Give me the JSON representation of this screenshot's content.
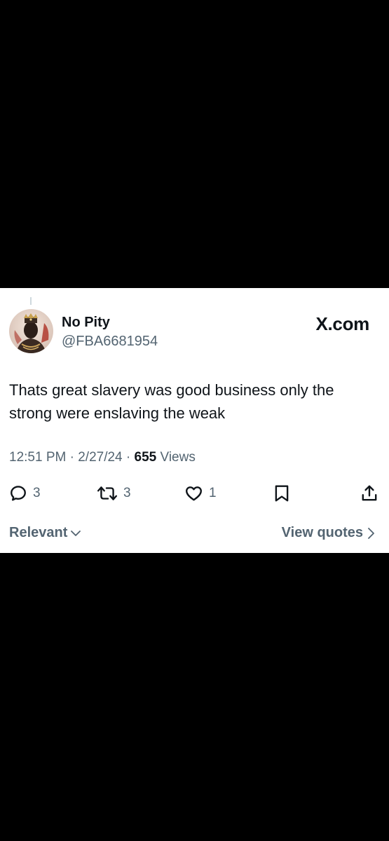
{
  "tweet": {
    "author_name": "No Pity",
    "author_handle": "@FBA6681954",
    "brand": "X.com",
    "text": "Thats great slavery was good business only the strong were enslaving the weak",
    "time": "12:51 PM",
    "date": "2/27/24",
    "separator": "·",
    "views_count": "655",
    "views_label": "Views"
  },
  "actions": {
    "replies": "3",
    "reposts": "3",
    "likes": "1"
  },
  "footer": {
    "sort_label": "Relevant",
    "view_quotes_label": "View quotes"
  },
  "icons": {
    "reply": "reply-icon",
    "repost": "repost-icon",
    "like": "heart-icon",
    "bookmark": "bookmark-icon",
    "share": "share-icon"
  },
  "colors": {
    "background": "#000000",
    "card": "#ffffff",
    "text_primary": "#0f1419",
    "text_secondary": "#536471"
  }
}
